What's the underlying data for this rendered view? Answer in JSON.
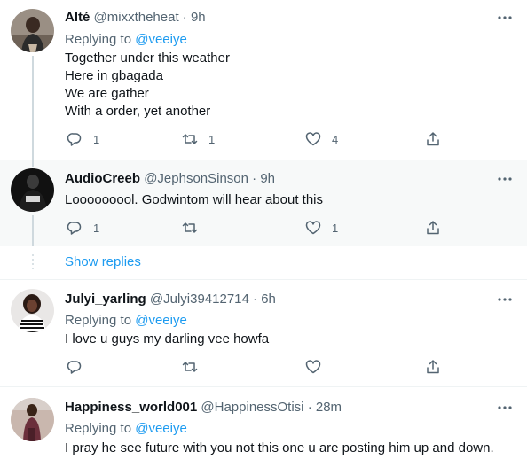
{
  "tweets": [
    {
      "name": "Alté",
      "handle": "@mixxtheheat",
      "time": "· 9h",
      "replying_prefix": "Replying to",
      "replying_handle": "@veeiye",
      "lines": [
        "Together under this weather",
        "Here in gbagada",
        "We are gather",
        "With a order, yet another"
      ],
      "reply_count": "1",
      "retweet_count": "1",
      "like_count": "4"
    },
    {
      "name": "AudioCreeb",
      "handle": "@JephsonSinson",
      "time": "· 9h",
      "lines": [
        "Looooooool. Godwintom will hear about this"
      ],
      "reply_count": "1",
      "retweet_count": "",
      "like_count": "1"
    },
    {
      "name": "Julyi_yarling",
      "handle": "@Julyi39412714",
      "time": "· 6h",
      "replying_prefix": "Replying to",
      "replying_handle": "@veeiye",
      "lines": [
        "I love u guys my darling vee howfa"
      ],
      "reply_count": "",
      "retweet_count": "",
      "like_count": ""
    },
    {
      "name": "Happiness_world001",
      "handle": "@HappinessOtisi",
      "time": "· 28m",
      "replying_prefix": "Replying to",
      "replying_handle": "@veeiye",
      "lines": [
        "I pray he see future with you not this one u are posting him up and down."
      ]
    }
  ],
  "show_replies_label": "Show replies",
  "colors": {
    "accent": "#1d9bf0",
    "secondary_text": "#536471",
    "highlight_bg": "#f7f9f9"
  }
}
